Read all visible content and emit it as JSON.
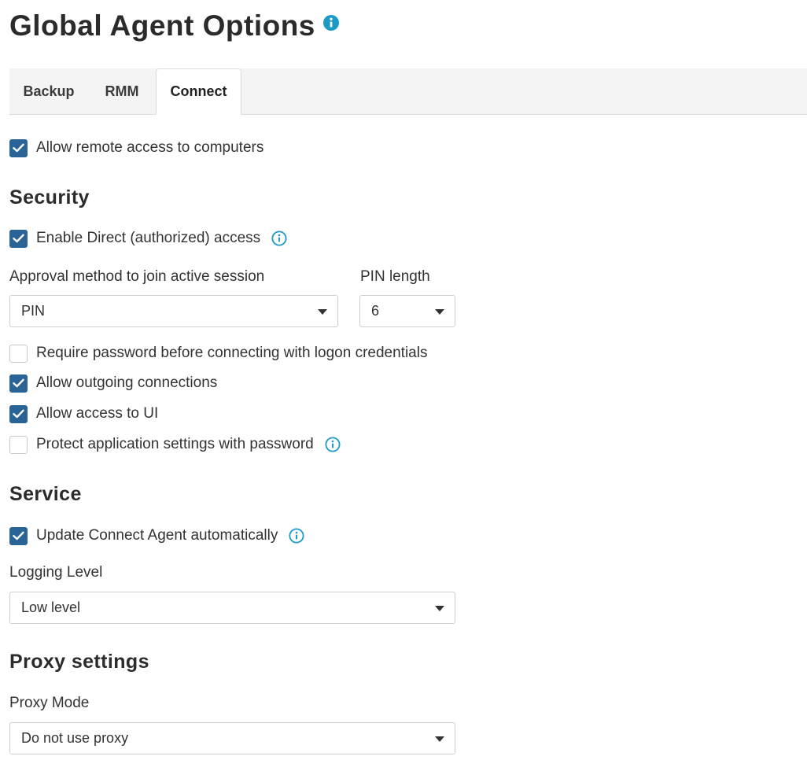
{
  "page": {
    "title": "Global Agent Options"
  },
  "tabs": [
    {
      "label": "Backup",
      "active": false
    },
    {
      "label": "RMM",
      "active": false
    },
    {
      "label": "Connect",
      "active": true
    }
  ],
  "general": {
    "allow_remote_access": {
      "label": "Allow remote access to computers",
      "checked": true
    }
  },
  "security": {
    "heading": "Security",
    "enable_direct_access": {
      "label": "Enable Direct (authorized) access",
      "checked": true
    },
    "approval_method": {
      "label": "Approval method to join active session",
      "value": "PIN"
    },
    "pin_length": {
      "label": "PIN length",
      "value": "6"
    },
    "require_password": {
      "label": "Require password before connecting with logon credentials",
      "checked": false
    },
    "allow_outgoing": {
      "label": "Allow outgoing connections",
      "checked": true
    },
    "allow_ui_access": {
      "label": "Allow access to UI",
      "checked": true
    },
    "protect_settings": {
      "label": "Protect application settings with password",
      "checked": false
    }
  },
  "service": {
    "heading": "Service",
    "update_agent": {
      "label": "Update Connect Agent automatically",
      "checked": true
    },
    "logging_level": {
      "label": "Logging Level",
      "value": "Low level"
    }
  },
  "proxy": {
    "heading": "Proxy settings",
    "proxy_mode": {
      "label": "Proxy Mode",
      "value": "Do not use proxy"
    }
  },
  "colors": {
    "accent": "#2a6496",
    "info": "#1a9ac4",
    "text": "#2b2b2b"
  },
  "icons": {
    "info": "info-circle-icon",
    "check": "checkmark-icon",
    "dropdown": "caret-down-icon"
  }
}
